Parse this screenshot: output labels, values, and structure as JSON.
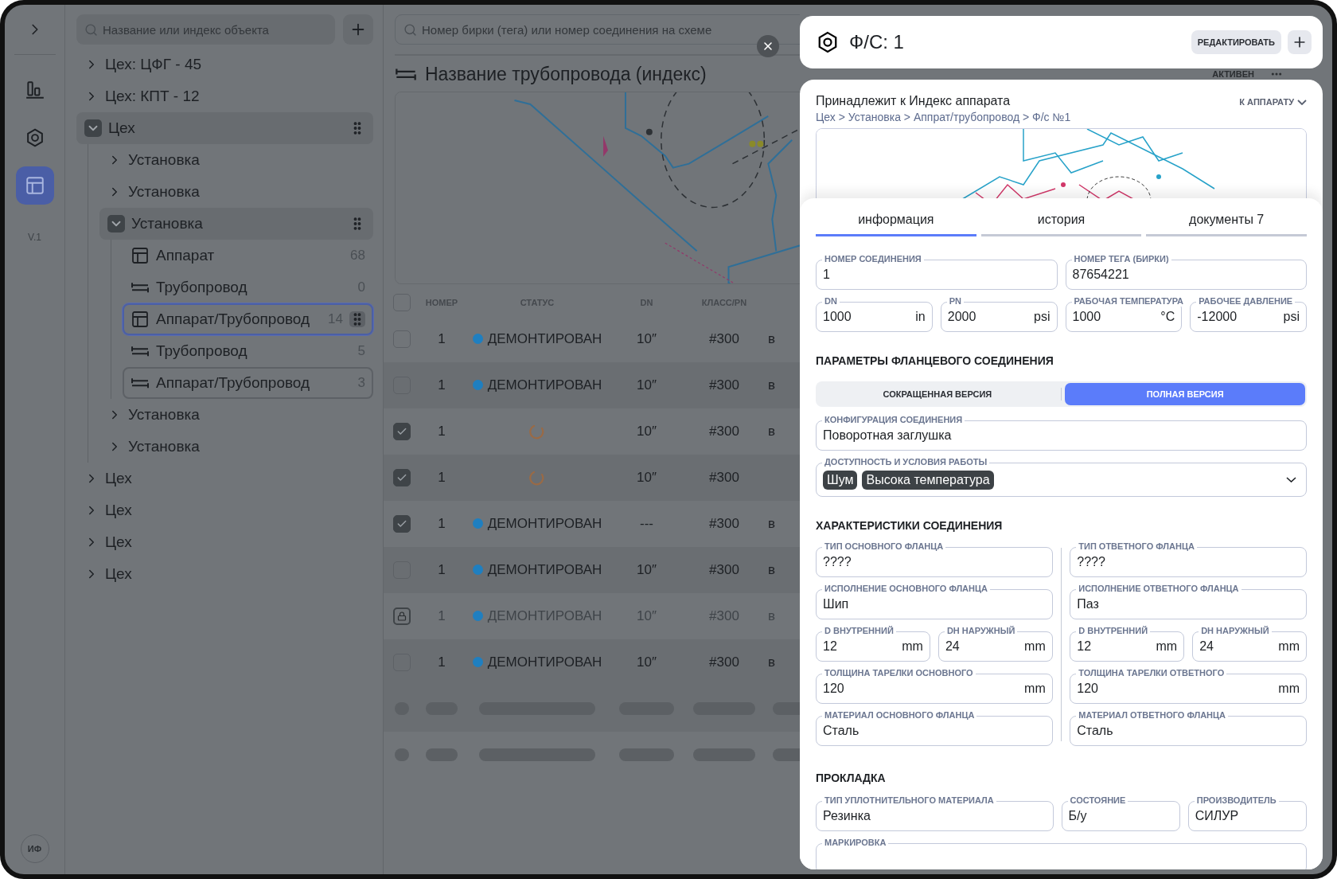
{
  "rail": {
    "items": [
      {
        "kind": "chart",
        "selected": false
      },
      {
        "kind": "nut",
        "selected": false
      },
      {
        "kind": "table",
        "selected": true
      }
    ],
    "version": "V.1",
    "avatar": "ИФ"
  },
  "tree": {
    "search_placeholder": "Название или индекс объекта",
    "items": [
      {
        "label": "Цех: ЦФГ - 45",
        "kind": "group",
        "expanded": false
      },
      {
        "label": "Цех: КПТ - 12",
        "kind": "group",
        "expanded": false
      },
      {
        "label": "Цех",
        "kind": "group",
        "expanded": true,
        "children": [
          {
            "label": "Установка",
            "kind": "group",
            "expanded": false
          },
          {
            "label": "Установка",
            "kind": "group",
            "expanded": false
          },
          {
            "label": "Установка",
            "kind": "group",
            "expanded": true,
            "children": [
              {
                "label": "Аппарат",
                "kind": "apparatus",
                "count": "68",
                "selected": false,
                "hovered": false
              },
              {
                "label": "Трубопровод",
                "kind": "pipeline",
                "count": "0",
                "selected": false,
                "hovered": false
              },
              {
                "label": "Аппарат/Трубопровод",
                "kind": "apparatus",
                "count": "14",
                "selected": true,
                "hovered": false
              },
              {
                "label": "Трубопровод",
                "kind": "pipeline",
                "count": "5",
                "selected": false,
                "hovered": false
              },
              {
                "label": "Аппарат/Трубопровод",
                "kind": "pipeline",
                "count": "3",
                "selected": false,
                "hovered": true
              }
            ]
          },
          {
            "label": "Установка",
            "kind": "group",
            "expanded": false
          },
          {
            "label": "Установка",
            "kind": "group",
            "expanded": false
          }
        ]
      },
      {
        "label": "Цех",
        "kind": "group",
        "expanded": false
      },
      {
        "label": "Цех",
        "kind": "group",
        "expanded": false
      },
      {
        "label": "Цех",
        "kind": "group",
        "expanded": false
      },
      {
        "label": "Цех",
        "kind": "group",
        "expanded": false
      }
    ]
  },
  "main": {
    "search_placeholder": "Номер бирки (тега) или номер соединения на схеме",
    "title": "Название трубопровода (индекс)",
    "status_menu": "АКТИВЕН"
  },
  "table": {
    "header_checked": false,
    "columns": [
      "НОМЕР",
      "СТАТУС",
      "DN",
      "КЛАСС/PN"
    ],
    "rows": [
      {
        "kind": "checkbox",
        "checked": false,
        "disabled": false,
        "number": "1",
        "status": {
          "kind": "label",
          "text": "ДЕМОНТИРОВАН",
          "color": "#1f7fc0"
        },
        "dn": "10″",
        "class": "#300",
        "column_6": "в"
      },
      {
        "kind": "checkbox",
        "checked": false,
        "disabled": false,
        "number": "1",
        "status": {
          "kind": "label",
          "text": "ДЕМОНТИРОВАН",
          "color": "#1f7fc0"
        },
        "dn": "10″",
        "class": "#300",
        "column_6": "в"
      },
      {
        "kind": "checkbox",
        "checked": true,
        "disabled": false,
        "number": "1",
        "status": {
          "kind": "loading"
        },
        "dn": "10″",
        "class": "#300",
        "column_6": "в"
      },
      {
        "kind": "checkbox",
        "checked": true,
        "disabled": false,
        "number": "1",
        "status": {
          "kind": "loading"
        },
        "dn": "10″",
        "class": "#300"
      },
      {
        "kind": "checkbox",
        "checked": true,
        "disabled": false,
        "number": "1",
        "status": {
          "kind": "label",
          "text": "ДЕМОНТИРОВАН",
          "color": "#1f7fc0"
        },
        "dn": "---",
        "class": "#300",
        "column_6": "в"
      },
      {
        "kind": "checkbox",
        "checked": false,
        "disabled": false,
        "number": "1",
        "status": {
          "kind": "label",
          "text": "ДЕМОНТИРОВАН",
          "color": "#1f7fc0"
        },
        "dn": "10″",
        "class": "#300",
        "column_6": "в"
      },
      {
        "kind": "locked",
        "checked": false,
        "disabled": true,
        "number": "1",
        "status": {
          "kind": "label",
          "text": "ДЕМОНТИРОВАН",
          "color": "#1f7fc0"
        },
        "dn": "10″",
        "class": "#300",
        "column_6": "в"
      },
      {
        "kind": "checkbox",
        "checked": false,
        "disabled": false,
        "number": "1",
        "status": {
          "kind": "label",
          "text": "ДЕМОНТИРОВАН",
          "color": "#1f7fc0"
        },
        "dn": "10″",
        "class": "#300",
        "column_6": "в"
      }
    ]
  },
  "panel": {
    "title": "Ф/С: 1",
    "edit_button": "РЕДАКТИРОВАТЬ",
    "owner": "Принадлежит к Индекс аппарата",
    "breadcrumb": "Цех > Установка > Аппрат/трубопровод > Ф/с №1",
    "goto": "К АППАРАТУ",
    "tabs": [
      {
        "label": "информация",
        "selected": true
      },
      {
        "label": "история",
        "selected": false
      },
      {
        "label": "документы 7",
        "selected": false
      }
    ],
    "general": [
      [
        {
          "label": "НОМЕР СОЕДИНЕНИЯ",
          "value": "1"
        },
        {
          "label": "НОМЕР ТЕГА (БИРКИ)",
          "value": "87654221"
        }
      ],
      [
        {
          "label": "DN",
          "value": "1000",
          "unit": "in"
        },
        {
          "label": "PN",
          "value": "2000",
          "unit": "psi"
        },
        {
          "label": "РАБОЧАЯ ТЕМПЕРАТУРА",
          "value": "1000",
          "unit": "°C"
        },
        {
          "label": "РАБОЧЕЕ ДАВЛЕНИЕ",
          "value": "-12000",
          "unit": "psi"
        }
      ]
    ],
    "flange": {
      "title": "ПАРАМЕТРЫ ФЛАНЦЕВОГО СОЕДИНЕНИЯ",
      "versions": [
        {
          "label": "СОКРАЩЕННАЯ ВЕРСИЯ",
          "selected": false
        },
        {
          "label": "ПОЛНАЯ ВЕРСИЯ",
          "selected": true
        }
      ],
      "configuration": {
        "label": "КОНФИГУРАЦИЯ СОЕДИНЕНИЯ",
        "value": "Поворотная заглушка"
      },
      "conditions": {
        "label": "ДОСТУПНОСТЬ И УСЛОВИЯ РАБОТЫ",
        "tags": [
          "Шум",
          "Высока температура"
        ]
      }
    },
    "characteristics": {
      "title": "ХАРАКТЕРИСТИКИ СОЕДИНЕНИЯ",
      "columns": [
        [
          [
            {
              "label": "ТИП ОСНОВНОГО ФЛАНЦА",
              "value": "????"
            }
          ],
          [
            {
              "label": "ИСПОЛНЕНИЕ ОСНОВНОГО ФЛАНЦА",
              "value": "Шип"
            }
          ],
          [
            {
              "label": "D ВНУТРЕННИЙ",
              "value": "12",
              "unit": "mm"
            },
            {
              "label": "DН НАРУЖНЫЙ",
              "value": "24",
              "unit": "mm"
            }
          ],
          [
            {
              "label": "ТОЛЩИНА ТАРЕЛКИ ОСНОВНОГО",
              "value": "120",
              "unit": "mm"
            }
          ],
          [
            {
              "label": "МАТЕРИАЛ ОСНОВНОГО ФЛАНЦА",
              "value": "Сталь"
            }
          ]
        ],
        [
          [
            {
              "label": "ТИП ОТВЕТНОГО ФЛАНЦА",
              "value": "????"
            }
          ],
          [
            {
              "label": "ИСПОЛНЕНИЕ ОТВЕТНОГО ФЛАНЦА",
              "value": "Паз"
            }
          ],
          [
            {
              "label": "D ВНУТРЕННИЙ",
              "value": "12",
              "unit": "mm"
            },
            {
              "label": "DН НАРУЖНЫЙ",
              "value": "24",
              "unit": "mm"
            }
          ],
          [
            {
              "label": "ТОЛЩИНА ТАРЕЛКИ ОТВЕТНОГО",
              "value": "120",
              "unit": "mm"
            }
          ],
          [
            {
              "label": "МАТЕРИАЛ ОТВЕТНОГО ФЛАНЦА",
              "value": "Сталь"
            }
          ]
        ]
      ]
    },
    "gasket": {
      "title": "ПРОКЛАДКА",
      "fields": [
        {
          "label": "ТИП УПЛОТНИТЕЛЬНОГО МАТЕРИАЛА",
          "value": "Резинка"
        },
        {
          "label": "СОСТОЯНИЕ",
          "value": "Б/у"
        },
        {
          "label": "ПРОИЗВОДИТЕЛЬ",
          "value": "СИЛУР"
        }
      ],
      "marking": {
        "label": "МАРКИРОВКА"
      }
    }
  }
}
